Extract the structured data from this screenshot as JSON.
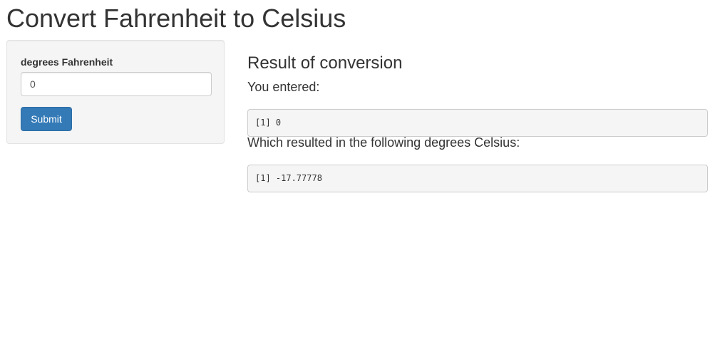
{
  "page": {
    "title": "Convert Fahrenheit to Celsius"
  },
  "sidebar": {
    "input_label": "degrees Fahrenheit",
    "input_value": "0",
    "submit_label": "Submit"
  },
  "main": {
    "heading": "Result of conversion",
    "entered_label": "You entered:",
    "entered_output": "[1] 0",
    "celsius_label": "Which resulted in the following degrees Celsius:",
    "celsius_output": "[1] -17.77778"
  },
  "colors": {
    "primary_button": "#337ab7",
    "panel_background": "#f5f5f5",
    "text": "#333333"
  }
}
